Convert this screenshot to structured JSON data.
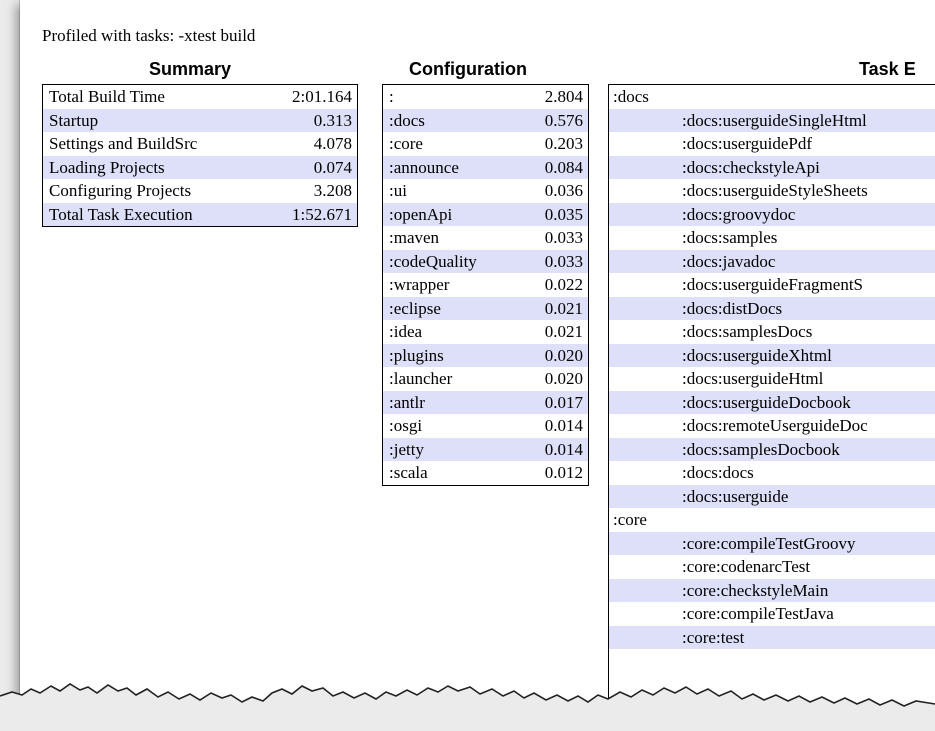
{
  "page_title": "Profiled with tasks: -xtest build",
  "summary": {
    "heading": "Summary",
    "rows": [
      {
        "label": "Total Build Time",
        "value": "2:01.164"
      },
      {
        "label": "Startup",
        "value": "0.313"
      },
      {
        "label": "Settings and BuildSrc",
        "value": "4.078"
      },
      {
        "label": "Loading Projects",
        "value": "0.074"
      },
      {
        "label": "Configuring Projects",
        "value": "3.208"
      },
      {
        "label": "Total Task Execution",
        "value": "1:52.671"
      }
    ]
  },
  "configuration": {
    "heading": "Configuration",
    "rows": [
      {
        "label": ":",
        "value": "2.804"
      },
      {
        "label": ":docs",
        "value": "0.576"
      },
      {
        "label": ":core",
        "value": "0.203"
      },
      {
        "label": ":announce",
        "value": "0.084"
      },
      {
        "label": ":ui",
        "value": "0.036"
      },
      {
        "label": ":openApi",
        "value": "0.035"
      },
      {
        "label": ":maven",
        "value": "0.033"
      },
      {
        "label": ":codeQuality",
        "value": "0.033"
      },
      {
        "label": ":wrapper",
        "value": "0.022"
      },
      {
        "label": ":eclipse",
        "value": "0.021"
      },
      {
        "label": ":idea",
        "value": "0.021"
      },
      {
        "label": ":plugins",
        "value": "0.020"
      },
      {
        "label": ":launcher",
        "value": "0.020"
      },
      {
        "label": ":antlr",
        "value": "0.017"
      },
      {
        "label": ":osgi",
        "value": "0.014"
      },
      {
        "label": ":jetty",
        "value": "0.014"
      },
      {
        "label": ":scala",
        "value": "0.012"
      }
    ]
  },
  "task_execution": {
    "heading": "Task E",
    "rows": [
      {
        "label": ":docs",
        "child": false
      },
      {
        "label": ":docs:userguideSingleHtml",
        "child": true
      },
      {
        "label": ":docs:userguidePdf",
        "child": true
      },
      {
        "label": ":docs:checkstyleApi",
        "child": true
      },
      {
        "label": ":docs:userguideStyleSheets",
        "child": true
      },
      {
        "label": ":docs:groovydoc",
        "child": true
      },
      {
        "label": ":docs:samples",
        "child": true
      },
      {
        "label": ":docs:javadoc",
        "child": true
      },
      {
        "label": ":docs:userguideFragmentS",
        "child": true
      },
      {
        "label": ":docs:distDocs",
        "child": true
      },
      {
        "label": ":docs:samplesDocs",
        "child": true
      },
      {
        "label": ":docs:userguideXhtml",
        "child": true
      },
      {
        "label": ":docs:userguideHtml",
        "child": true
      },
      {
        "label": ":docs:userguideDocbook",
        "child": true
      },
      {
        "label": ":docs:remoteUserguideDoc",
        "child": true
      },
      {
        "label": ":docs:samplesDocbook",
        "child": true
      },
      {
        "label": ":docs:docs",
        "child": true
      },
      {
        "label": ":docs:userguide",
        "child": true
      },
      {
        "label": ":core",
        "child": false
      },
      {
        "label": ":core:compileTestGroovy",
        "child": true
      },
      {
        "label": ":core:codenarcTest",
        "child": true
      },
      {
        "label": ":core:checkstyleMain",
        "child": true
      },
      {
        "label": ":core:compileTestJava",
        "child": true
      },
      {
        "label": ":core:test",
        "child": true
      }
    ]
  },
  "colors": {
    "alt_row": "#dde0f8",
    "background": "#ebebeb",
    "paper": "#ffffff"
  }
}
